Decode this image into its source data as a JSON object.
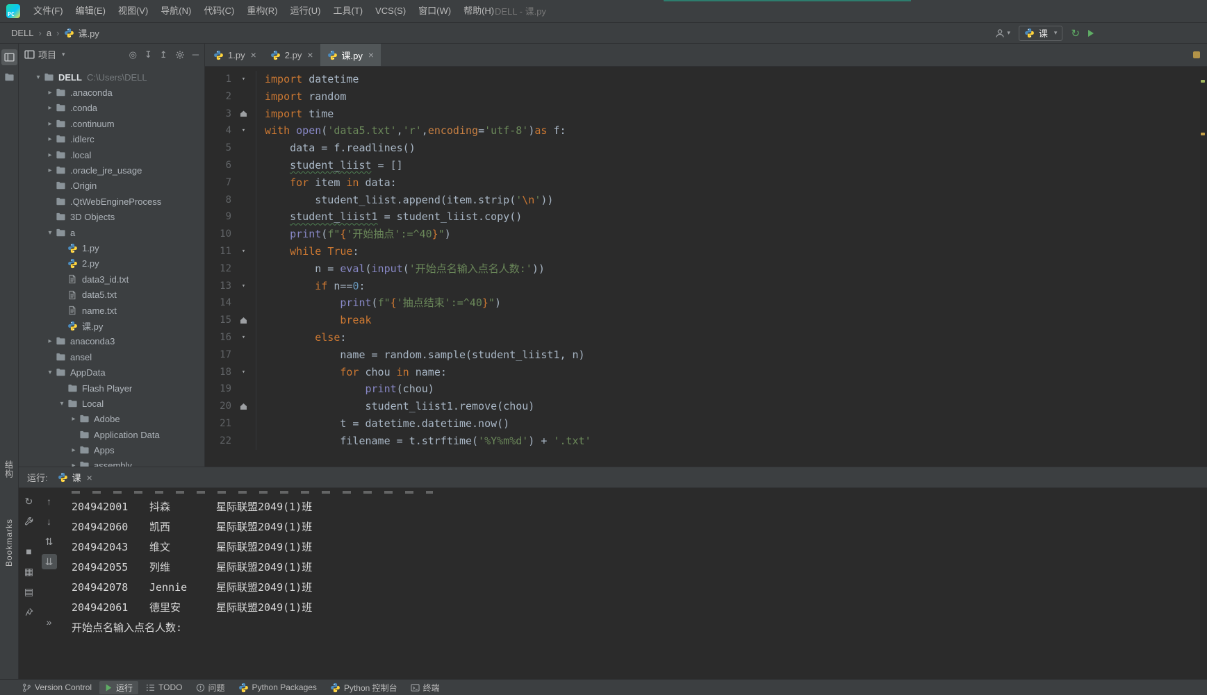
{
  "colors": {
    "bg_editor": "#2b2b2b",
    "bg_panel": "#3c3f41",
    "accent_teal": "#2d7d6e",
    "keyword_orange": "#cc7832",
    "string_green": "#6a8759",
    "number_blue": "#6897bb",
    "builtin_purple": "#8888c6",
    "text_gray": "#a9b7c6",
    "run_green": "#5fad65",
    "stop_red": "#c75450",
    "python_blue": "#4b8bbe",
    "python_yellow": "#ffd43b"
  },
  "menubar": {
    "logo": "PC",
    "items": [
      "文件(F)",
      "编辑(E)",
      "视图(V)",
      "导航(N)",
      "代码(C)",
      "重构(R)",
      "运行(U)",
      "工具(T)",
      "VCS(S)",
      "窗口(W)",
      "帮助(H)"
    ],
    "window_title": "DELL - 课.py"
  },
  "navbar": {
    "breadcrumbs": [
      "DELL",
      "a",
      "课.py"
    ],
    "run_config": "课"
  },
  "left_strip": {
    "top_icons": [
      {
        "name": "project",
        "active": true
      },
      {
        "name": "folder",
        "active": false
      }
    ],
    "bottom_labels": [
      "结构",
      "Bookmarks"
    ]
  },
  "project": {
    "header": {
      "title": "项目",
      "icons": [
        "target",
        "expand-all",
        "collapse-all",
        "settings",
        "hide"
      ]
    },
    "tree": [
      {
        "label": "DELL",
        "suffix": "C:\\Users\\DELL",
        "type": "folder",
        "level": 0,
        "chevron": "open",
        "bold": true
      },
      {
        "label": ".anaconda",
        "type": "folder",
        "level": 1,
        "chevron": "closed"
      },
      {
        "label": ".conda",
        "type": "folder",
        "level": 1,
        "chevron": "closed"
      },
      {
        "label": ".continuum",
        "type": "folder",
        "level": 1,
        "chevron": "closed"
      },
      {
        "label": ".idlerc",
        "type": "folder",
        "level": 1,
        "chevron": "closed"
      },
      {
        "label": ".local",
        "type": "folder",
        "level": 1,
        "chevron": "closed"
      },
      {
        "label": ".oracle_jre_usage",
        "type": "folder",
        "level": 1,
        "chevron": "closed"
      },
      {
        "label": ".Origin",
        "type": "folder",
        "level": 1,
        "chevron": "none"
      },
      {
        "label": ".QtWebEngineProcess",
        "type": "folder",
        "level": 1,
        "chevron": "none"
      },
      {
        "label": "3D Objects",
        "type": "folder",
        "level": 1,
        "chevron": "none"
      },
      {
        "label": "a",
        "type": "folder",
        "level": 1,
        "chevron": "open"
      },
      {
        "label": "1.py",
        "type": "py",
        "level": 2,
        "chevron": "none"
      },
      {
        "label": "2.py",
        "type": "py",
        "level": 2,
        "chevron": "none"
      },
      {
        "label": "data3_id.txt",
        "type": "txt",
        "level": 2,
        "chevron": "none"
      },
      {
        "label": "data5.txt",
        "type": "txt",
        "level": 2,
        "chevron": "none"
      },
      {
        "label": "name.txt",
        "type": "txt",
        "level": 2,
        "chevron": "none"
      },
      {
        "label": "课.py",
        "type": "py",
        "level": 2,
        "chevron": "none"
      },
      {
        "label": "anaconda3",
        "type": "folder",
        "level": 1,
        "chevron": "closed"
      },
      {
        "label": "ansel",
        "type": "folder",
        "level": 1,
        "chevron": "none"
      },
      {
        "label": "AppData",
        "type": "folder",
        "level": 1,
        "chevron": "open"
      },
      {
        "label": "Flash Player",
        "type": "folder",
        "level": 2,
        "chevron": "none"
      },
      {
        "label": "Local",
        "type": "folder",
        "level": 2,
        "chevron": "open"
      },
      {
        "label": "Adobe",
        "type": "folder",
        "level": 3,
        "chevron": "closed"
      },
      {
        "label": "Application Data",
        "type": "folder",
        "level": 3,
        "chevron": "none"
      },
      {
        "label": "Apps",
        "type": "folder",
        "level": 3,
        "chevron": "closed"
      },
      {
        "label": "assembly",
        "type": "folder",
        "level": 3,
        "chevron": "closed"
      }
    ]
  },
  "tabs": [
    {
      "label": "1.py",
      "active": false
    },
    {
      "label": "2.py",
      "active": false
    },
    {
      "label": "课.py",
      "active": true
    }
  ],
  "editor": {
    "lines": [
      {
        "n": 1,
        "fold": "v",
        "tokens": [
          [
            "kw",
            "import"
          ],
          [
            "p",
            " datetime"
          ]
        ]
      },
      {
        "n": 2,
        "fold": null,
        "tokens": [
          [
            "kw",
            "import"
          ],
          [
            "p",
            " random"
          ]
        ]
      },
      {
        "n": 3,
        "fold": "e",
        "tokens": [
          [
            "kw",
            "import"
          ],
          [
            "p",
            " time"
          ]
        ]
      },
      {
        "n": 4,
        "fold": "v",
        "tokens": [
          [
            "kw",
            "with"
          ],
          [
            "p",
            " "
          ],
          [
            "bi",
            "open"
          ],
          [
            "p",
            "("
          ],
          [
            "str",
            "'data5.txt'"
          ],
          [
            "p",
            ","
          ],
          [
            "str",
            "'r'"
          ],
          [
            "p",
            ","
          ],
          [
            "kwarg",
            "encoding"
          ],
          [
            "p",
            "="
          ],
          [
            "str",
            "'utf-8'"
          ],
          [
            "p",
            ")"
          ],
          [
            "kw",
            "as"
          ],
          [
            "p",
            " f:"
          ]
        ]
      },
      {
        "n": 5,
        "fold": null,
        "tokens": [
          [
            "p",
            "    data = f.readlines()"
          ]
        ]
      },
      {
        "n": 6,
        "fold": null,
        "tokens": [
          [
            "p",
            "    "
          ],
          [
            "typo",
            "student_liist"
          ],
          [
            "p",
            " = []"
          ]
        ]
      },
      {
        "n": 7,
        "fold": null,
        "tokens": [
          [
            "p",
            "    "
          ],
          [
            "kw",
            "for"
          ],
          [
            "p",
            " item "
          ],
          [
            "kw",
            "in"
          ],
          [
            "p",
            " data:"
          ]
        ]
      },
      {
        "n": 8,
        "fold": null,
        "tokens": [
          [
            "p",
            "        student_liist.append(item.strip("
          ],
          [
            "str",
            "'"
          ],
          [
            "esc",
            "\\n"
          ],
          [
            "str",
            "'"
          ],
          [
            "p",
            "))"
          ]
        ]
      },
      {
        "n": 9,
        "fold": null,
        "tokens": [
          [
            "p",
            "    "
          ],
          [
            "typo",
            "student_liist1"
          ],
          [
            "p",
            " = student_liist.copy()"
          ]
        ]
      },
      {
        "n": 10,
        "fold": null,
        "tokens": [
          [
            "p",
            "    "
          ],
          [
            "bi",
            "print"
          ],
          [
            "p",
            "("
          ],
          [
            "str",
            "f\""
          ],
          [
            "esc",
            "{"
          ],
          [
            "str",
            "'开始抽点'"
          ],
          [
            "str",
            ":=^40"
          ],
          [
            "esc",
            "}"
          ],
          [
            "str",
            "\""
          ],
          [
            "p",
            ")"
          ]
        ]
      },
      {
        "n": 11,
        "fold": "v",
        "tokens": [
          [
            "p",
            "    "
          ],
          [
            "kw",
            "while"
          ],
          [
            "p",
            " "
          ],
          [
            "kw",
            "True"
          ],
          [
            "p",
            ":"
          ]
        ]
      },
      {
        "n": 12,
        "fold": null,
        "tokens": [
          [
            "p",
            "        n = "
          ],
          [
            "bi",
            "eval"
          ],
          [
            "p",
            "("
          ],
          [
            "bi",
            "input"
          ],
          [
            "p",
            "("
          ],
          [
            "str",
            "'开始点名输入点名人数:'"
          ],
          [
            "p",
            "))"
          ]
        ]
      },
      {
        "n": 13,
        "fold": "v",
        "tokens": [
          [
            "p",
            "        "
          ],
          [
            "kw",
            "if"
          ],
          [
            "p",
            " n=="
          ],
          [
            "num",
            "0"
          ],
          [
            "p",
            ":"
          ]
        ]
      },
      {
        "n": 14,
        "fold": null,
        "tokens": [
          [
            "p",
            "            "
          ],
          [
            "bi",
            "print"
          ],
          [
            "p",
            "("
          ],
          [
            "str",
            "f\""
          ],
          [
            "esc",
            "{"
          ],
          [
            "str",
            "'抽点结束'"
          ],
          [
            "str",
            ":=^40"
          ],
          [
            "esc",
            "}"
          ],
          [
            "str",
            "\""
          ],
          [
            "p",
            ")"
          ]
        ]
      },
      {
        "n": 15,
        "fold": "e",
        "tokens": [
          [
            "p",
            "            "
          ],
          [
            "kw",
            "break"
          ]
        ]
      },
      {
        "n": 16,
        "fold": "v",
        "tokens": [
          [
            "p",
            "        "
          ],
          [
            "kw",
            "else"
          ],
          [
            "p",
            ":"
          ]
        ]
      },
      {
        "n": 17,
        "fold": null,
        "tokens": [
          [
            "p",
            "            name = random.sample(student_liist1, n)"
          ]
        ]
      },
      {
        "n": 18,
        "fold": "v",
        "tokens": [
          [
            "p",
            "            "
          ],
          [
            "kw",
            "for"
          ],
          [
            "p",
            " chou "
          ],
          [
            "kw",
            "in"
          ],
          [
            "p",
            " name:"
          ]
        ]
      },
      {
        "n": 19,
        "fold": null,
        "tokens": [
          [
            "p",
            "                "
          ],
          [
            "bi",
            "print"
          ],
          [
            "p",
            "(chou)"
          ]
        ]
      },
      {
        "n": 20,
        "fold": "e",
        "tokens": [
          [
            "p",
            "                student_liist1.remove(chou)"
          ]
        ]
      },
      {
        "n": 21,
        "fold": null,
        "tokens": [
          [
            "p",
            "            t = datetime.datetime.now()"
          ]
        ]
      },
      {
        "n": 22,
        "fold": null,
        "tokens": [
          [
            "p",
            "            filename = t.strftime("
          ],
          [
            "str",
            "'%Y%m%d'"
          ],
          [
            "p",
            ") + "
          ],
          [
            "str",
            "'.txt'"
          ]
        ]
      }
    ]
  },
  "console": {
    "title": "运行:",
    "tab": "课",
    "toolbar_outer": [
      "rerun",
      "wrench",
      "stop",
      "layout",
      "print",
      "pin"
    ],
    "toolbar_inner": [
      "up",
      "down",
      "swap",
      "scroll-end",
      "more"
    ],
    "rows": [
      {
        "id": "204942001",
        "name": "抖森",
        "cls": "星际联盟2049(1)班"
      },
      {
        "id": "204942060",
        "name": "凯西",
        "cls": "星际联盟2049(1)班"
      },
      {
        "id": "204942043",
        "name": "维文",
        "cls": "星际联盟2049(1)班"
      },
      {
        "id": "204942055",
        "name": "列维",
        "cls": "星际联盟2049(1)班"
      },
      {
        "id": "204942078",
        "name": "Jennie",
        "cls": "星际联盟2049(1)班"
      },
      {
        "id": "204942061",
        "name": "德里安",
        "cls": "星际联盟2049(1)班"
      }
    ],
    "prompt": "开始点名输入点名人数:"
  },
  "bottom_bar": {
    "items": [
      {
        "label": "Version Control",
        "icon": "branch",
        "active": false
      },
      {
        "label": "运行",
        "icon": "play",
        "active": true
      },
      {
        "label": "TODO",
        "icon": "todo",
        "active": false
      },
      {
        "label": "问题",
        "icon": "issues",
        "active": false
      },
      {
        "label": "Python Packages",
        "icon": "python",
        "active": false
      },
      {
        "label": "Python 控制台",
        "icon": "python",
        "active": false
      },
      {
        "label": "终端",
        "icon": "terminal",
        "active": false
      }
    ]
  }
}
